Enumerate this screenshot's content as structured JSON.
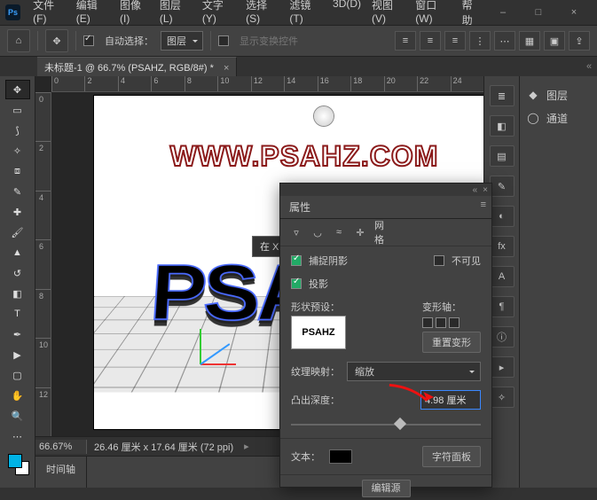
{
  "app": {
    "logo": "Ps"
  },
  "menus": [
    "文件(F)",
    "编辑(E)",
    "图像(I)",
    "图层(L)",
    "文字(Y)",
    "选择(S)",
    "滤镜(T)",
    "3D(D)",
    "视图(V)",
    "窗口(W)",
    "帮助"
  ],
  "window_controls": {
    "min": "–",
    "max": "□",
    "close": "×"
  },
  "options": {
    "auto_select_label": "自动选择：",
    "auto_select_value": "图层",
    "show_transform_label": "显示变换控件"
  },
  "doc_tab": {
    "title": "未标题-1 @ 66.7% (PSAHZ, RGB/8#) *",
    "close": "×"
  },
  "ruler_h": [
    "0",
    "2",
    "4",
    "6",
    "8",
    "10",
    "12",
    "14",
    "16",
    "18",
    "20",
    "22",
    "24"
  ],
  "ruler_v": [
    "0",
    "2",
    "4",
    "6",
    "8",
    "10",
    "12"
  ],
  "canvas": {
    "watermark": "WWW.PSAHZ.COM",
    "text3d": "PSA",
    "tooltip": "在 XY 平面上移动"
  },
  "status": {
    "zoom": "66.67%",
    "info": "26.46 厘米 x 17.64 厘米 (72 ppi)"
  },
  "bottom_panel": {
    "tab": "时间轴"
  },
  "right_panel": {
    "layers": "图层",
    "channels": "通道"
  },
  "properties": {
    "tab": "属性",
    "mesh_label": "网格",
    "catch_shadow": "捕捉阴影",
    "invisible": "不可见",
    "cast_shadow": "投影",
    "shape_preset": "形状预设：",
    "preset_name": "PSAHZ",
    "deform_axis": "变形轴：",
    "reset_deform": "重置变形",
    "texture_map": "纹理映射：",
    "texture_value": "缩放",
    "extrude_depth": "凸出深度：",
    "extrude_value": "4.98 厘米",
    "text_label": "文本：",
    "char_panel": "字符面板",
    "edit_source": "编辑源"
  }
}
